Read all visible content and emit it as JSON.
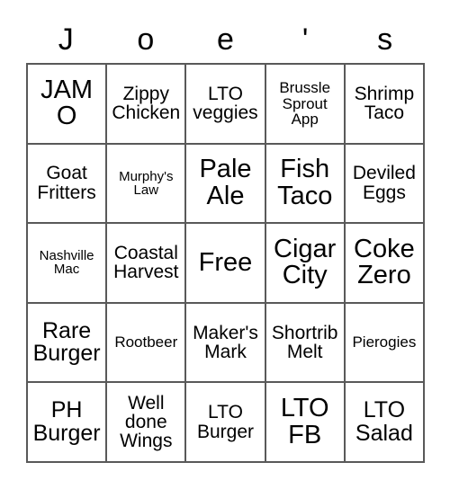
{
  "card": {
    "title_letters": [
      "J",
      "o",
      "e",
      "'",
      "s"
    ],
    "title_text": "Joe's",
    "columns": 5,
    "rows": 5,
    "border_color": "#595959",
    "text_color": "#000000",
    "background_color": "#ffffff",
    "cells": [
      [
        {
          "label": "JAMO",
          "size": "fs-xl",
          "free": false
        },
        {
          "label": "Zippy\nChicken",
          "size": "fs-md",
          "free": false
        },
        {
          "label": "LTO\nveggies",
          "size": "fs-md",
          "free": false
        },
        {
          "label": "Brussle\nSprout\nApp",
          "size": "fs-sm",
          "free": false
        },
        {
          "label": "Shrimp\nTaco",
          "size": "fs-md",
          "free": false
        }
      ],
      [
        {
          "label": "Goat\nFritters",
          "size": "fs-md",
          "free": false
        },
        {
          "label": "Murphy's\nLaw",
          "size": "fs-xs",
          "free": false
        },
        {
          "label": "Pale\nAle",
          "size": "fs-xl",
          "free": false
        },
        {
          "label": "Fish\nTaco",
          "size": "fs-xl",
          "free": false
        },
        {
          "label": "Deviled\nEggs",
          "size": "fs-md",
          "free": false
        }
      ],
      [
        {
          "label": "Nashville\nMac",
          "size": "fs-xs",
          "free": false
        },
        {
          "label": "Coastal\nHarvest",
          "size": "fs-md",
          "free": false
        },
        {
          "label": "Free",
          "size": "fs-xl",
          "free": true
        },
        {
          "label": "Cigar\nCity",
          "size": "fs-xl",
          "free": false
        },
        {
          "label": "Coke\nZero",
          "size": "fs-xl",
          "free": false
        }
      ],
      [
        {
          "label": "Rare\nBurger",
          "size": "fs-lg",
          "free": false
        },
        {
          "label": "Rootbeer",
          "size": "fs-sm",
          "free": false
        },
        {
          "label": "Maker's\nMark",
          "size": "fs-md",
          "free": false
        },
        {
          "label": "Shortrib\nMelt",
          "size": "fs-md",
          "free": false
        },
        {
          "label": "Pierogies",
          "size": "fs-sm",
          "free": false
        }
      ],
      [
        {
          "label": "PH\nBurger",
          "size": "fs-lg",
          "free": false
        },
        {
          "label": "Well\ndone\nWings",
          "size": "fs-md",
          "free": false
        },
        {
          "label": "LTO\nBurger",
          "size": "fs-md",
          "free": false
        },
        {
          "label": "LTO\nFB",
          "size": "fs-xl",
          "free": false
        },
        {
          "label": "LTO\nSalad",
          "size": "fs-lg",
          "free": false
        }
      ]
    ]
  }
}
